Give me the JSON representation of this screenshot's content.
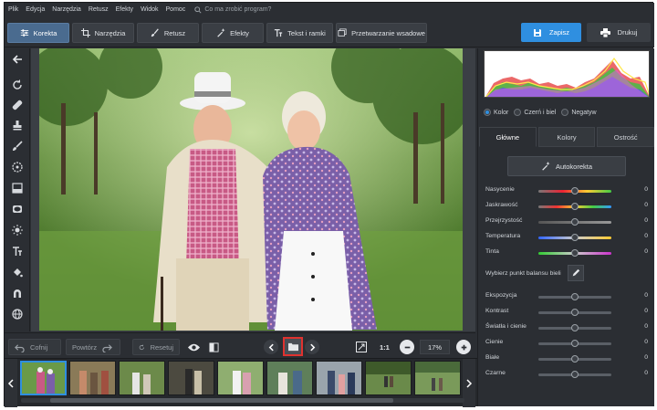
{
  "menu": {
    "items": [
      "Plik",
      "Edycja",
      "Narzędzia",
      "Retusz",
      "Efekty",
      "Widok",
      "Pomoc"
    ],
    "search_placeholder": "Co ma zrobić program?"
  },
  "tabs": [
    {
      "label": "Korekta",
      "icon": "sliders-icon",
      "active": true
    },
    {
      "label": "Narzędzia",
      "icon": "crop-icon"
    },
    {
      "label": "Retusz",
      "icon": "brush-icon"
    },
    {
      "label": "Efekty",
      "icon": "magic-wand-icon"
    },
    {
      "label": "Tekst i ramki",
      "icon": "text-icon"
    },
    {
      "label": "Przetwarzanie wsadowe",
      "icon": "batch-icon"
    }
  ],
  "actions": {
    "save": "Zapisz",
    "print": "Drukuj"
  },
  "bottom": {
    "undo": "Cofnij",
    "redo": "Powtórz",
    "reset": "Resetuj",
    "one_to_one": "1:1",
    "zoom": "17%"
  },
  "right_panel": {
    "modes": [
      {
        "label": "Kolor",
        "checked": true
      },
      {
        "label": "Czerń i biel",
        "checked": false
      },
      {
        "label": "Negatyw",
        "checked": false
      }
    ],
    "tabs": [
      {
        "label": "Główne",
        "active": true
      },
      {
        "label": "Kolory",
        "active": false
      },
      {
        "label": "Ostrość",
        "active": false
      }
    ],
    "auto_button": "Autokorekta",
    "sliders_top": [
      {
        "label": "Nasycenie",
        "value": "0",
        "gradient": "linear-gradient(90deg,#777,#e23,#fc3,#4c4)"
      },
      {
        "label": "Jaskrawość",
        "value": "0",
        "gradient": "linear-gradient(90deg,#777,#e33,#fc3,#4c4,#39f)"
      },
      {
        "label": "Przejrzystość",
        "value": "0",
        "gradient": "linear-gradient(90deg,#555,#999)"
      },
      {
        "label": "Temperatura",
        "value": "0",
        "gradient": "linear-gradient(90deg,#36f,#ccc,#fc3)"
      },
      {
        "label": "Tinta",
        "value": "0",
        "gradient": "linear-gradient(90deg,#3c3,#ccc,#c3c)"
      }
    ],
    "white_balance": "Wybierz punkt balansu bieli",
    "sliders_bottom": [
      {
        "label": "Ekspozycja",
        "value": "0"
      },
      {
        "label": "Kontrast",
        "value": "0"
      },
      {
        "label": "Światła i cienie",
        "value": "0"
      },
      {
        "label": "Cienie",
        "value": "0"
      },
      {
        "label": "Białe",
        "value": "0"
      },
      {
        "label": "Czarne",
        "value": "0"
      }
    ]
  },
  "colors": {
    "accent": "#2f8fe0",
    "highlight": "#e0322f",
    "panel": "#2b2e33"
  }
}
